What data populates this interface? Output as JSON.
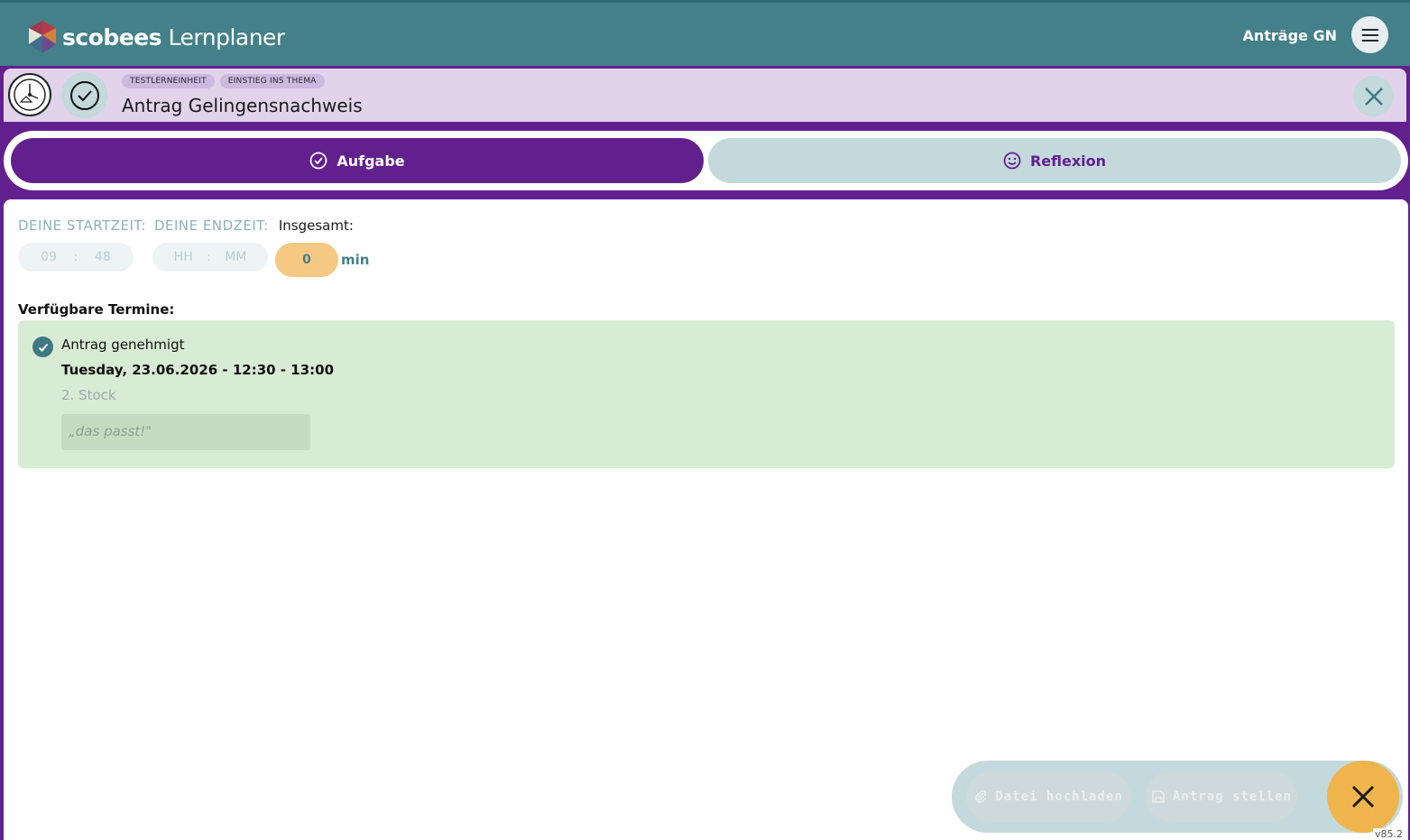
{
  "header": {
    "brand_bold": "scobees",
    "brand_light": "Lernplaner",
    "user_label": "Anträge GN"
  },
  "task": {
    "tags": [
      "TESTLERNEINHEIT",
      "EINSTIEG INS THEMA"
    ],
    "title": "Antrag Gelingensnachweis"
  },
  "tabs": [
    {
      "label": "Aufgabe",
      "active": true
    },
    {
      "label": "Reflexion",
      "active": false
    }
  ],
  "time": {
    "start_label": "DEINE STARTZEIT:",
    "end_label": "DEINE ENDZEIT:",
    "total_label": "Insgesamt:",
    "start_hh": "09",
    "start_mm": "48",
    "end_hh_placeholder": "HH",
    "end_mm_placeholder": "MM",
    "separator": ":",
    "total_value": "0",
    "total_unit": "min"
  },
  "termine": {
    "heading": "Verfügbare Termine:",
    "items": [
      {
        "status": "Antrag genehmigt",
        "date": "Tuesday, 23.06.2026 - 12:30 - 13:00",
        "room": "2. Stock",
        "comment": "„das passt!\""
      }
    ]
  },
  "actions": {
    "upload_label": "Datei hochladen",
    "submit_label": "Antrag stellen"
  },
  "version": "v85.2",
  "colors": {
    "header_bg": "#43808a",
    "primary_purple": "#62208f",
    "accent_orange": "#f0b44c",
    "success_green": "#d8ebd4"
  }
}
